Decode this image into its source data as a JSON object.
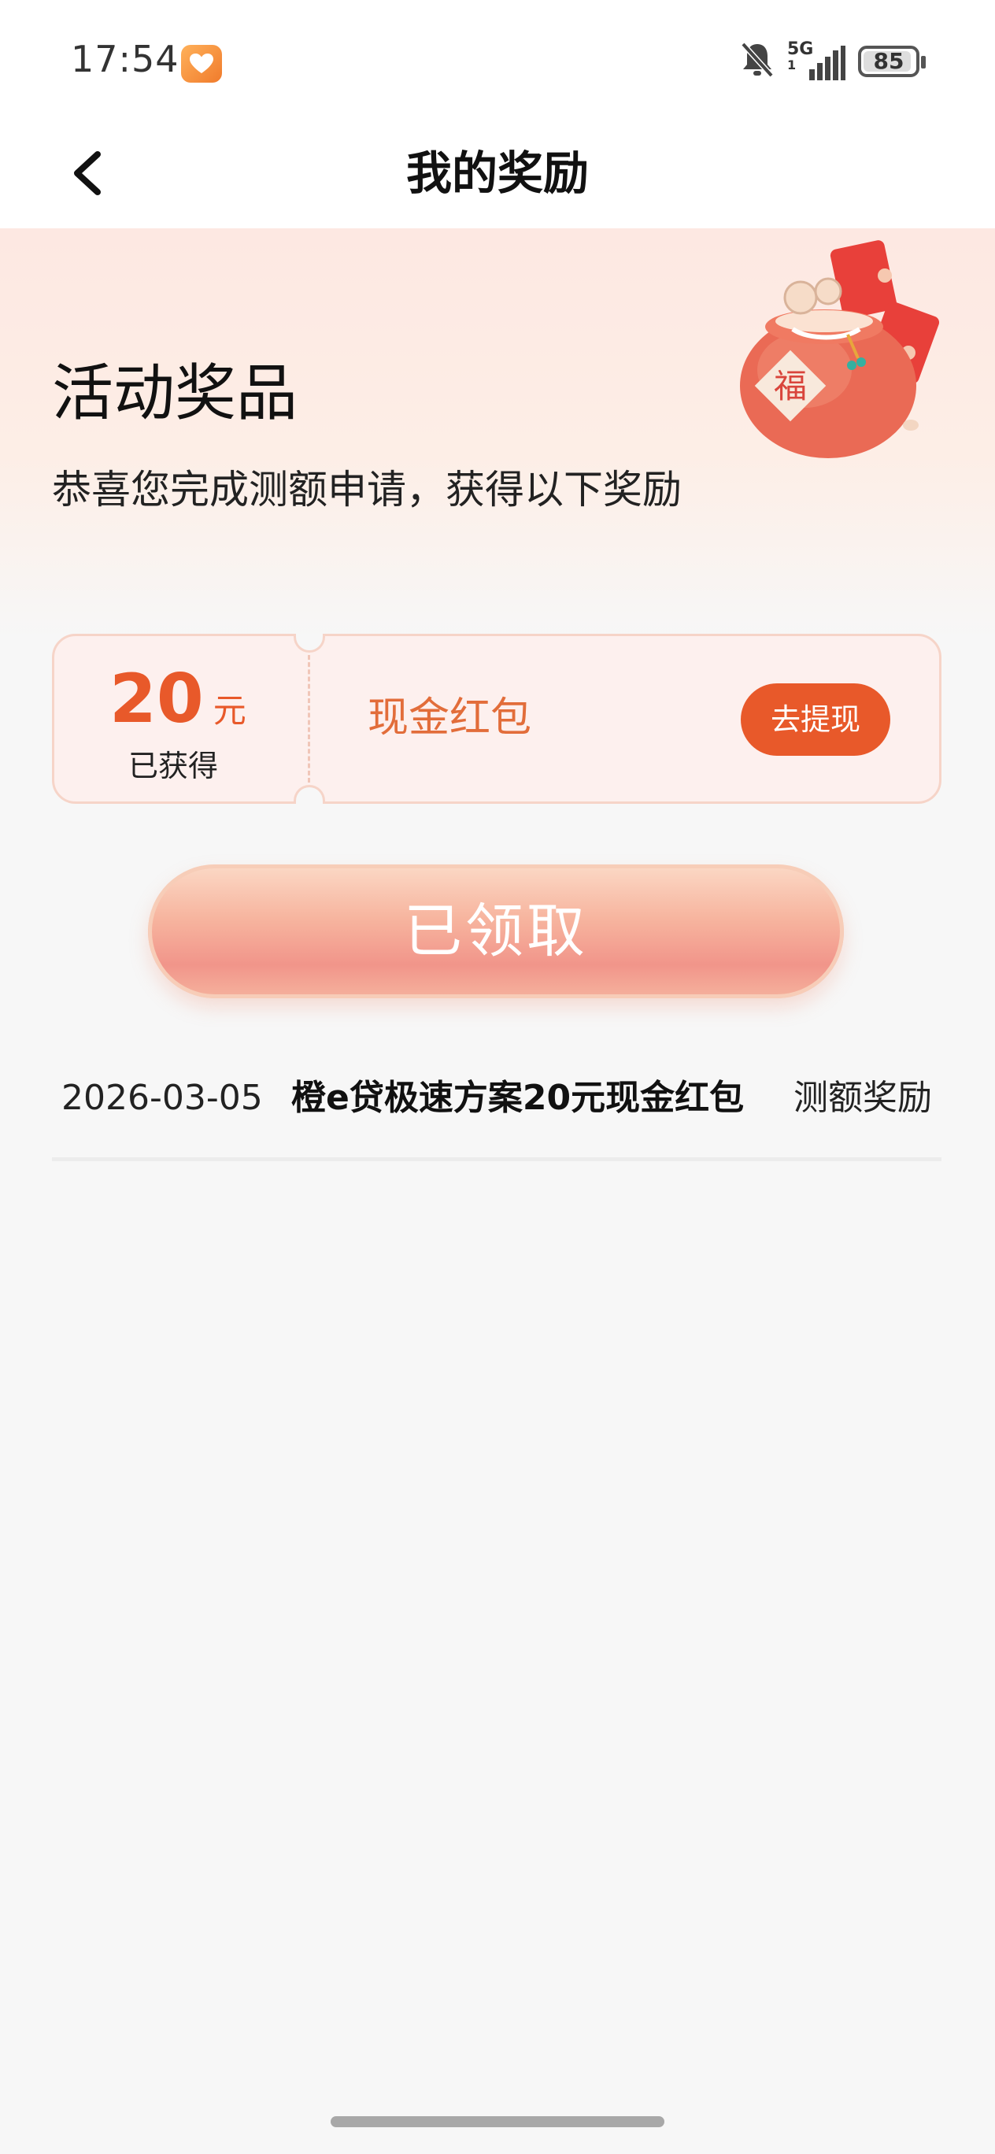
{
  "status_bar": {
    "time": "17:54",
    "app_badge_icon": "heart-icon",
    "network": "5G",
    "sim": "1",
    "battery_level": "85"
  },
  "nav": {
    "back_icon": "chevron-left-icon",
    "title": "我的奖励"
  },
  "hero": {
    "title": "活动奖品",
    "subtitle": "恭喜您完成测额申请，获得以下奖励",
    "image_icon": "lucky-bag-icon",
    "image_text": "福"
  },
  "reward_card": {
    "amount": "20",
    "unit": "元",
    "status": "已获得",
    "name": "现金红包",
    "action_label": "去提现"
  },
  "claimed_button": {
    "label": "已领取"
  },
  "records": [
    {
      "date": "2026-03-05",
      "name": "橙e贷极速方案20元现金红包",
      "type": "测额奖励"
    }
  ],
  "colors": {
    "accent": "#e8592a",
    "reward_text": "#e26d3a",
    "card_bg": "#fdf0ee",
    "page_bg": "#f7f7f7"
  }
}
